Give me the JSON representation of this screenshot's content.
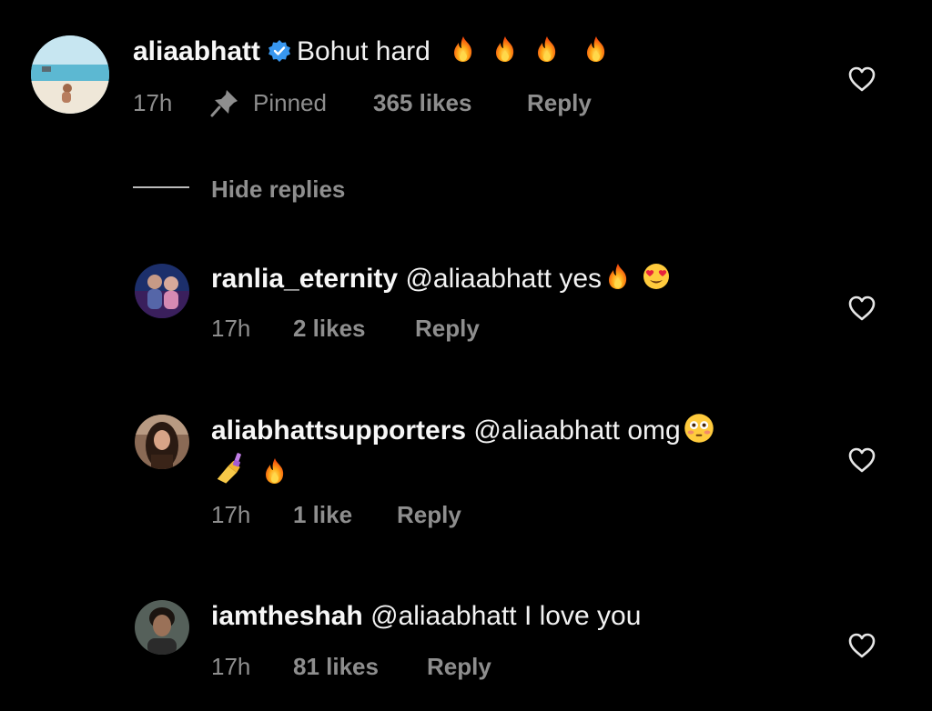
{
  "main_comment": {
    "username": "aliaabhatt",
    "text": "Bohut hard",
    "time": "17h",
    "pinned_label": "Pinned",
    "likes": "365 likes",
    "reply_label": "Reply",
    "emojis": [
      "fire-emoji",
      "fire-emoji",
      "fire-emoji",
      "fire-emoji"
    ]
  },
  "hide_replies_label": "Hide replies",
  "replies": [
    {
      "username": "ranlia_eternity",
      "mention": "@aliaabhatt",
      "text": "yes",
      "time": "17h",
      "likes": "2 likes",
      "reply_label": "Reply",
      "emojis": [
        "fire-emoji",
        "heart-eyes-emoji"
      ]
    },
    {
      "username": "aliabhattsupporters",
      "mention": "@aliaabhatt",
      "text": "omg",
      "time": "17h",
      "likes": "1 like",
      "reply_label": "Reply",
      "emojis": [
        "flushed-emoji",
        "nail-polish-emoji",
        "fire-emoji"
      ]
    },
    {
      "username": "iamtheshah",
      "mention": "@aliaabhatt",
      "text": "I love you",
      "time": "17h",
      "likes": "81 likes",
      "reply_label": "Reply",
      "emojis": []
    }
  ],
  "colors": {
    "background": "#000000",
    "text": "#f5f5f5",
    "secondary": "#8e8e8e",
    "verified": "#3897f0",
    "fire": "#ff7a00"
  }
}
